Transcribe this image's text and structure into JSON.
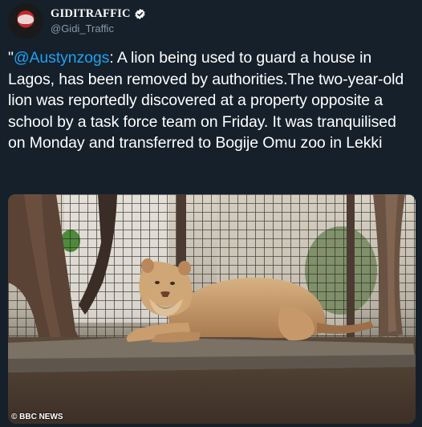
{
  "account": {
    "display_name": "GIDITRAFFIC",
    "handle": "@Gidi_Traffic",
    "verified": true,
    "avatar_icon": "giditraffic-logo-avatar",
    "verified_icon": "verified-badge-icon"
  },
  "tweet": {
    "open_quote": "\"",
    "mention": "@Austynzogs",
    "body": ": A lion being used to guard a house in Lagos, has been removed by authorities.The two-year-old lion was reportedly discovered at a property opposite a school by a task force team on Friday. It was tranquilised on Monday and transferred to Bogije Omu zoo in Lekki"
  },
  "media": {
    "watermark": "© BBC NEWS"
  },
  "colors": {
    "background": "#15202b",
    "text": "#ffffff",
    "secondary": "#8899a6",
    "link": "#1da1f2"
  }
}
